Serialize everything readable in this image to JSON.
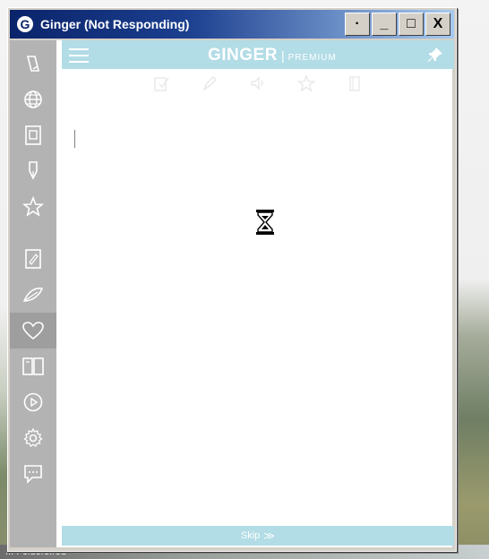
{
  "window": {
    "title": "Ginger (Not Responding)",
    "app_icon_letter": "G",
    "buttons": {
      "dot": "·",
      "minimize": "_",
      "maximize": "□",
      "close": "X"
    }
  },
  "desktop": {
    "label": "... Folders.red"
  },
  "topbar": {
    "brand_name": "GINGER",
    "brand_sep": "|",
    "brand_tier": "PREMIUM"
  },
  "sidebar": {
    "items": [
      {
        "icon": "pencil-icon"
      },
      {
        "icon": "globe-icon"
      },
      {
        "icon": "dictionary-icon"
      },
      {
        "icon": "pen-nib-icon"
      },
      {
        "icon": "star-icon"
      },
      {
        "icon": "notebook-icon"
      },
      {
        "icon": "feather-icon"
      },
      {
        "icon": "heart-icon",
        "active": true
      },
      {
        "icon": "book-icon"
      },
      {
        "icon": "play-icon"
      },
      {
        "icon": "gear-icon"
      },
      {
        "icon": "chat-icon"
      }
    ]
  },
  "toolbar": {
    "tools": [
      "check-document-icon",
      "rephrase-icon",
      "speaker-icon",
      "favorite-icon",
      "copy-icon"
    ]
  },
  "bottom": {
    "skip_label": "Skip",
    "skip_arrow": "≫"
  },
  "colors": {
    "accent": "#b2dce6",
    "sidebar": "#b3b3b3",
    "sidebar_active": "#9e9e9e",
    "titlebar_start": "#0a246a",
    "titlebar_end": "#a6caf0"
  }
}
